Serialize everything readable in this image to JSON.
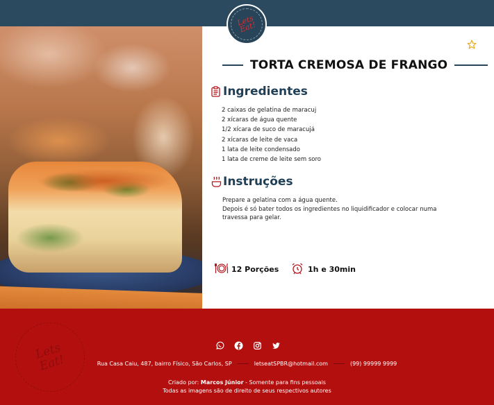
{
  "header": {
    "logo_text": "Lets Eat!"
  },
  "recipe": {
    "title": "TORTA CREMOSA DE FRANGO",
    "favorite_icon": "star-outline-icon",
    "ingredients_heading": "Ingredientes",
    "ingredients": [
      "2 caixas de gelatina de maracuj",
      "2 xícaras de água quente",
      "1/2 xícara de suco de maracujá",
      "2 xícaras de leite de vaca",
      "1 lata de leite condensado",
      "1 lata de creme de leite sem soro"
    ],
    "instructions_heading": "Instruções",
    "instructions": [
      "Prepare a gelatina com a água quente.",
      "Depois é só bater todos os ingredientes no liquidificador e colocar numa travessa para gelar."
    ],
    "portions": "12 Porções",
    "time": "1h e 30min"
  },
  "footer": {
    "watermark_text": "Lets Eat!",
    "socials": [
      "whatsapp-icon",
      "facebook-icon",
      "instagram-icon",
      "twitter-icon"
    ],
    "address": "Rua Casa Caiu, 487, bairro Físico, São Carlos, SP",
    "email": "letseatSPBR@hotmail.com",
    "phone": "(99) 99999 9999",
    "credit_prefix": "Criado por:",
    "credit_name": "Marcos Júnior",
    "credit_suffix": " - Somente para fins pessoais",
    "rights": "Todas as imagens são de direito de seus respectivos autores"
  },
  "colors": {
    "header_bg": "#2c4a5f",
    "footer_bg": "#b40f0f",
    "accent_red": "#b5161d",
    "heading_blue": "#1f3f57",
    "star": "#e7a823"
  }
}
